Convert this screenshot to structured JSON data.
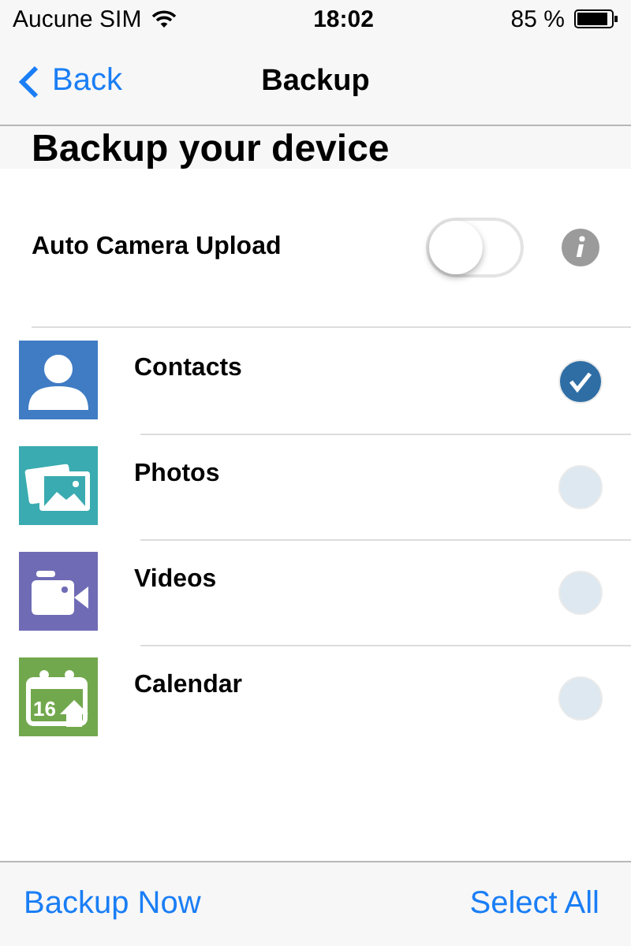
{
  "status_bar": {
    "carrier": "Aucune SIM",
    "time": "18:02",
    "battery": "85 %"
  },
  "nav": {
    "back": "Back",
    "title": "Backup"
  },
  "heading": "Backup your device",
  "auto_upload": {
    "label": "Auto Camera Upload",
    "on": false
  },
  "items": [
    {
      "kind": "contacts",
      "label": "Contacts",
      "color": "#3f7cc4",
      "checked": true
    },
    {
      "kind": "photos",
      "label": "Photos",
      "color": "#3aabb0",
      "checked": false
    },
    {
      "kind": "videos",
      "label": "Videos",
      "color": "#6f6bb5",
      "checked": false
    },
    {
      "kind": "calendar",
      "label": "Calendar",
      "color": "#72a84d",
      "checked": false,
      "icon_text": "16"
    }
  ],
  "toolbar": {
    "left": "Backup Now",
    "right": "Select All"
  }
}
